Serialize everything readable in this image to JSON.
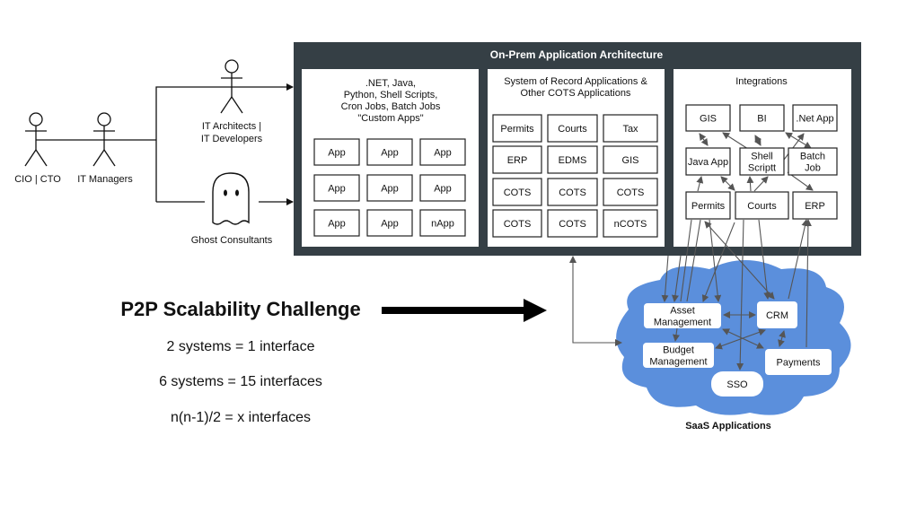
{
  "actors": {
    "cio": "CIO | CTO",
    "managers": "IT Managers",
    "architects": [
      "IT Architects |",
      "IT Developers"
    ],
    "ghost": "Ghost Consultants"
  },
  "onprem": {
    "title": "On-Prem Application Architecture",
    "custom": {
      "title_lines": [
        ".NET, Java,",
        "Python, Shell Scripts,",
        "Cron Jobs, Batch Jobs",
        "\"Custom Apps\""
      ],
      "boxes": [
        "App",
        "App",
        "App",
        "App",
        "App",
        "App",
        "App",
        "App",
        "nApp"
      ]
    },
    "sor": {
      "title_lines": [
        "System of Record Applications &",
        "Other COTS Applications"
      ],
      "boxes": [
        "Permits",
        "Courts",
        "Tax",
        "ERP",
        "EDMS",
        "GIS",
        "COTS",
        "COTS",
        "COTS",
        "COTS",
        "COTS",
        "nCOTS"
      ]
    },
    "integrations": {
      "title": "Integrations",
      "gis": "GIS",
      "bi": "BI",
      "netapp": ".Net App",
      "javaapp": "Java App",
      "shell": [
        "Shell",
        "Scriptt"
      ],
      "batch": [
        "Batch",
        "Job"
      ],
      "permits": "Permits",
      "courts": "Courts",
      "erp": "ERP"
    }
  },
  "challenge": {
    "title": "P2P Scalability Challenge",
    "lines": [
      "2 systems = 1 interface",
      "6 systems = 15 interfaces",
      "n(n-1)/2 = x interfaces"
    ]
  },
  "saas": {
    "label": "SaaS Applications",
    "asset": [
      "Asset",
      "Management"
    ],
    "crm": "CRM",
    "budget": [
      "Budget",
      "Management"
    ],
    "payments": "Payments",
    "sso": "SSO"
  },
  "colors": {
    "container": "#353f45",
    "cloud": "#5b8fdc",
    "arrow": "#555555"
  }
}
